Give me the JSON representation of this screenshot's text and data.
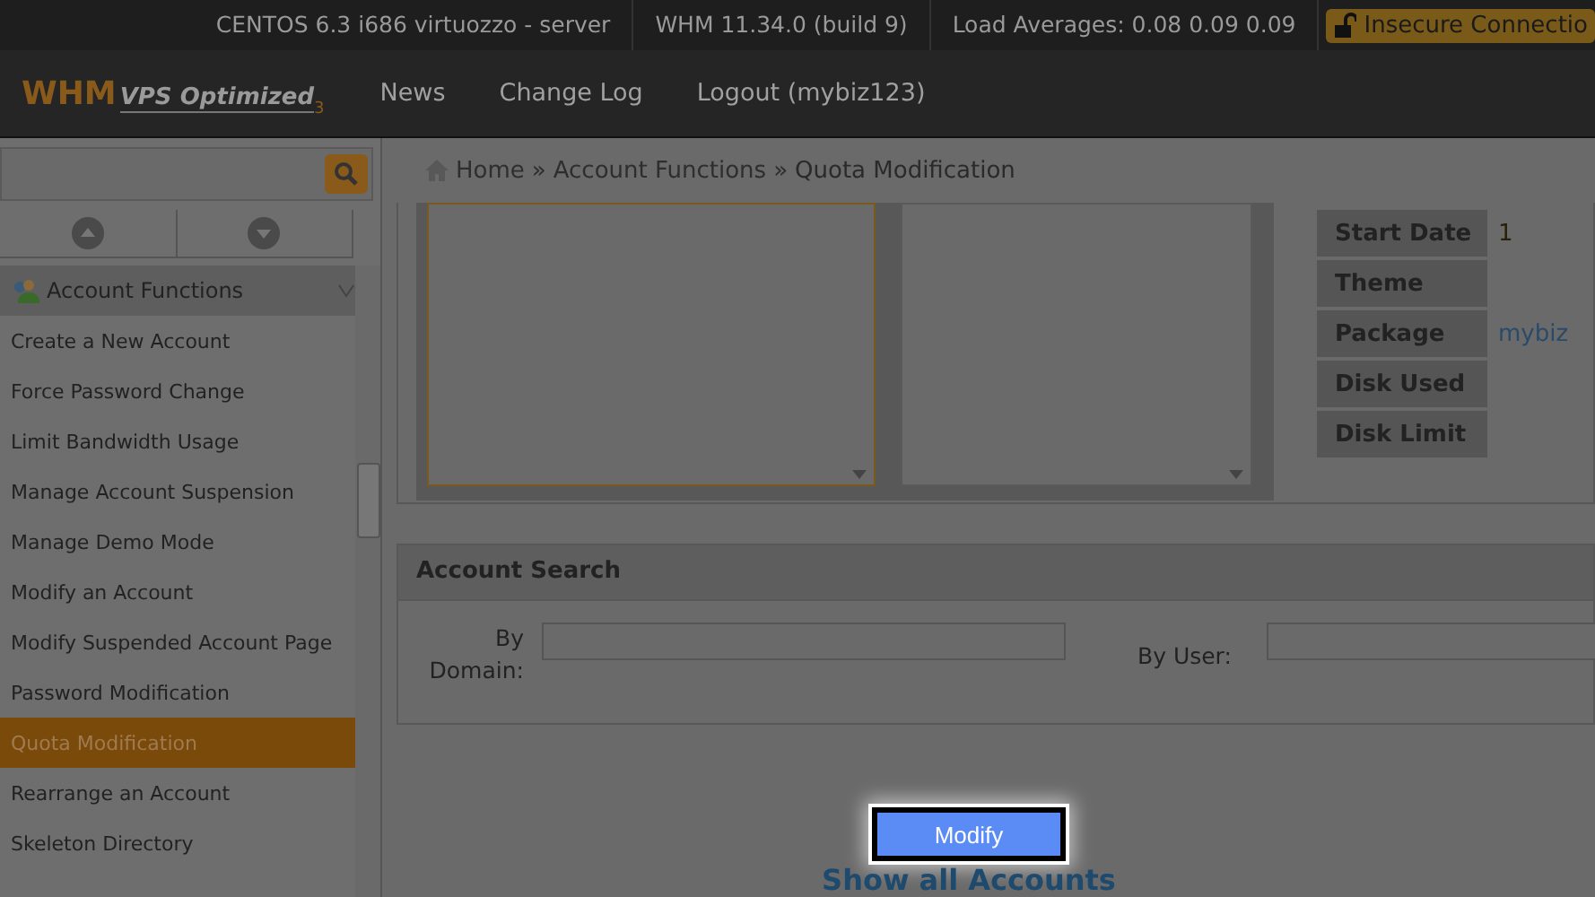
{
  "top_bar": {
    "items": [
      "CENTOS 6.3 i686 virtuozzo - server",
      "WHM 11.34.0 (build 9)",
      "Load Averages: 0.08 0.09 0.09"
    ],
    "security_badge": "Insecure Connectio"
  },
  "header": {
    "logo": {
      "brand": "WHM",
      "product": "VPS Optimized",
      "version": "3"
    },
    "nav": [
      "News",
      "Change Log",
      "Logout (mybiz123)"
    ]
  },
  "breadcrumb": {
    "separator": "»",
    "items": [
      "Home",
      "Account Functions",
      "Quota Modification"
    ]
  },
  "sidebar": {
    "group": "Account Functions",
    "items": [
      {
        "label": "Create a New Account",
        "selected": false
      },
      {
        "label": "Force Password Change",
        "selected": false
      },
      {
        "label": "Limit Bandwidth Usage",
        "selected": false
      },
      {
        "label": "Manage Account Suspension",
        "selected": false
      },
      {
        "label": "Manage Demo Mode",
        "selected": false
      },
      {
        "label": "Modify an Account",
        "selected": false
      },
      {
        "label": "Modify Suspended Account Page",
        "selected": false
      },
      {
        "label": "Password Modification",
        "selected": false
      },
      {
        "label": "Quota Modification",
        "selected": true
      },
      {
        "label": "Rearrange an Account",
        "selected": false
      },
      {
        "label": "Skeleton Directory",
        "selected": false
      }
    ]
  },
  "account_info": [
    {
      "label": "Start Date",
      "value": "1"
    },
    {
      "label": "Theme"
    },
    {
      "label": "Package",
      "value": "mybiz"
    },
    {
      "label": "Disk Used"
    },
    {
      "label": "Disk Limit"
    }
  ],
  "account_search": {
    "title": "Account Search",
    "fields": [
      "By Domain:",
      "By User:"
    ]
  },
  "modify_button": "Modify",
  "show_all_link": "Show all Accounts"
}
